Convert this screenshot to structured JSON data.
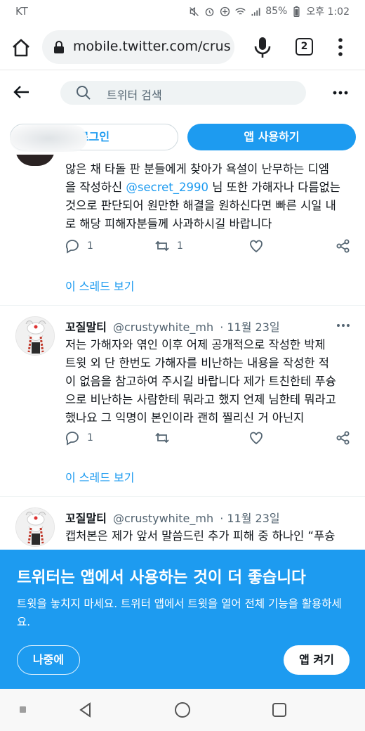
{
  "status": {
    "carrier": "KT",
    "battery": "85%",
    "time": "오후 1:02"
  },
  "browser": {
    "url": "mobile.twitter.com/crus",
    "tab_count": "2"
  },
  "twitter_bar": {
    "search_placeholder": "트위터 검색"
  },
  "cta": {
    "login_label": "로그인",
    "app_label": "앱 사용하기"
  },
  "tweets": [
    {
      "text_lines": [
        "않은 채 타돌 판 분들에게 찾아가 욕설이 난무하는 디엠",
        "을 작성하신 ",
        " 님 또한 가해자나 다름없는",
        "것으로 판단되어 원만한 해결을 원하신다면 빠른 시일 내",
        "로 해당 피해자분들께 사과하시길 바랍니다"
      ],
      "mention": "@secret_2990",
      "replies": "1",
      "retweets": "1",
      "thread_link": "이 스레드 보기"
    },
    {
      "name": "꼬질말티",
      "handle": "@crustywhite_mh",
      "date": "· 11월 23일",
      "text_lines": [
        "저는 가해자와 엮인 이후 어제 공개적으로 작성한 박제",
        "트윗 외 단 한번도 가해자를 비난하는 내용을 작성한 적",
        "이 없음을 참고하여 주시길 바랍니다 제가 트친한테 푸슝",
        "으로 비난하는 사람한테 뭐라고 했지 언제 님한테 뭐라고",
        "했나요 그 익명이 본인이라 괜히 찔리신 거 아닌지"
      ],
      "replies": "1",
      "thread_link": "이 스레드 보기"
    },
    {
      "name": "꼬질말티",
      "handle": "@crustywhite_mh",
      "date": "· 11월 23일",
      "text_lines": [
        "캡처본은 제가 앞서 말씀드린 추가 피해 중 하나인 “푸슝"
      ]
    }
  ],
  "banner": {
    "title": "트위터는 앱에서 사용하는 것이 더 좋습니다",
    "description": "트윗을 놓치지 마세요. 트위터 앱에서 트윗을 열어 전체 기능을 활용하세요.",
    "later_label": "나중에",
    "open_label": "앱 켜기"
  },
  "colors": {
    "twitter_blue": "#1d9bf0",
    "text": "#0f1419",
    "muted": "#536471"
  }
}
